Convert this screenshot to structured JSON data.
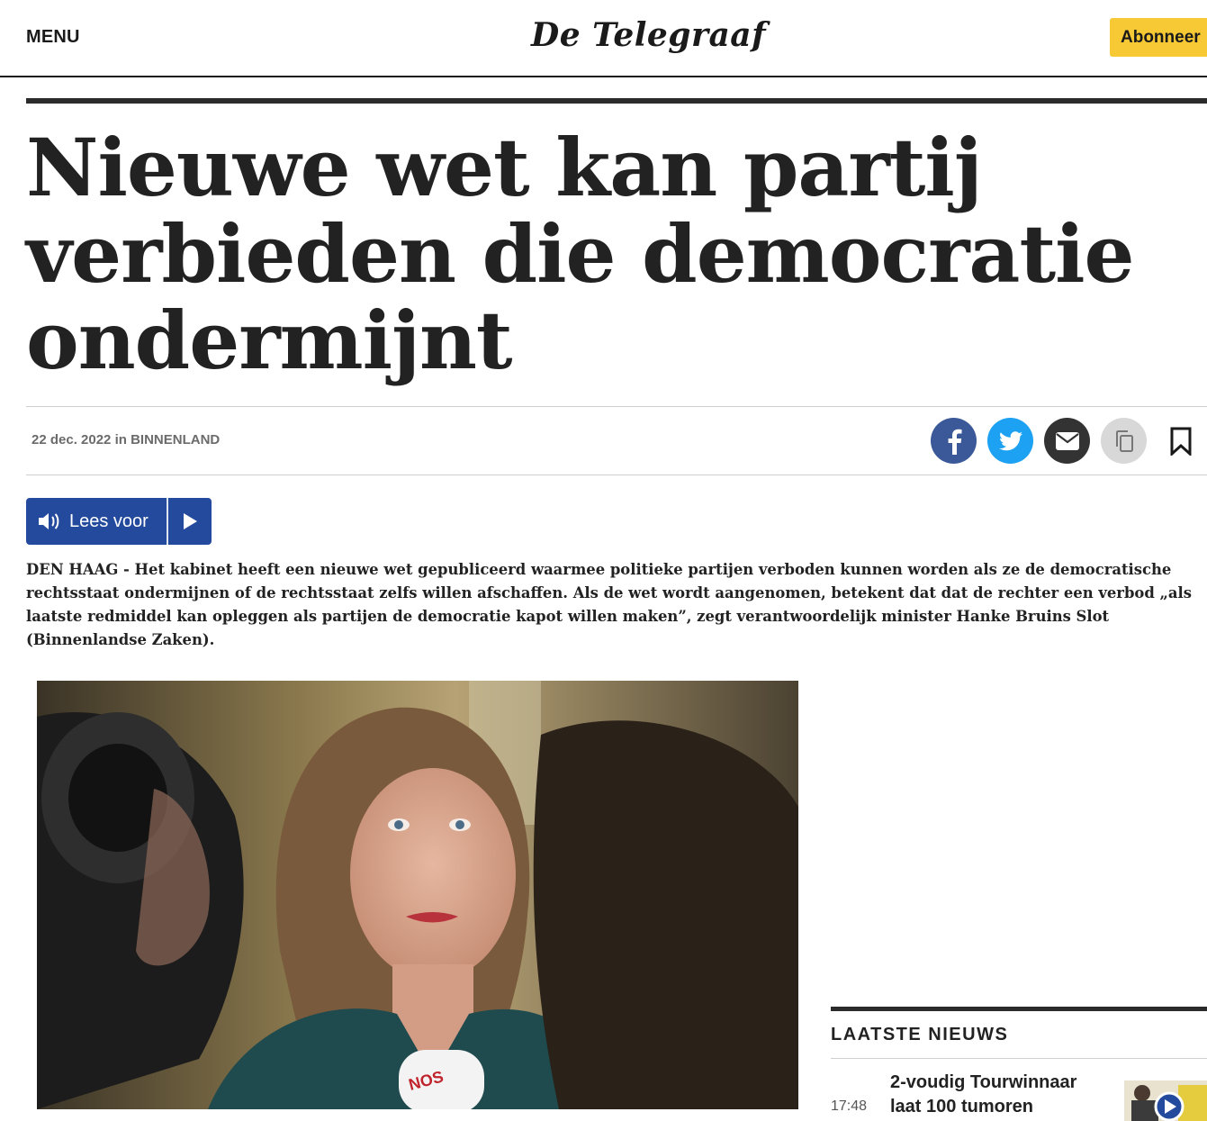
{
  "header": {
    "menu_label": "MENU",
    "logo_text": "De Telegraaf",
    "subscribe_label": "Abonneer"
  },
  "article": {
    "headline": "Nieuwe wet kan partij verbieden die democratie ondermijnt",
    "date": "22 dec. 2022",
    "in_word": "in",
    "category": "BINNENLAND",
    "listen_label": "Lees voor",
    "lead": "DEN HAAG - Het kabinet heeft een nieuwe wet gepubliceerd waarmee politieke partijen verboden kunnen worden als ze de democratische rechtsstaat ondermijnen of de rechtsstaat zelfs willen afschaffen. Als de wet wordt aangenomen, betekent dat dat de rechter een verbod „als laatste redmiddel kan opleggen als partijen de democratie kapot willen maken”, zegt verantwoordelijk minister Hanke Bruins Slot (Binnenlandse Zaken).",
    "photo_mic_text": "NOS"
  },
  "share": {
    "icons": [
      "facebook-icon",
      "twitter-icon",
      "mail-icon",
      "copy-icon",
      "bookmark-icon"
    ],
    "colors": {
      "facebook": "#3b5998",
      "twitter": "#1da1f2",
      "mail": "#333333",
      "copy": "#d8d8d8"
    }
  },
  "sidebar": {
    "latest_title": "LAATSTE NIEUWS",
    "items": [
      {
        "time": "17:48",
        "title": "2-voudig Tourwinnaar laat 100 tumoren"
      }
    ]
  },
  "colors": {
    "subscribe_bg": "#f7c934",
    "listen_bg": "#234a9c",
    "text": "#222222"
  }
}
